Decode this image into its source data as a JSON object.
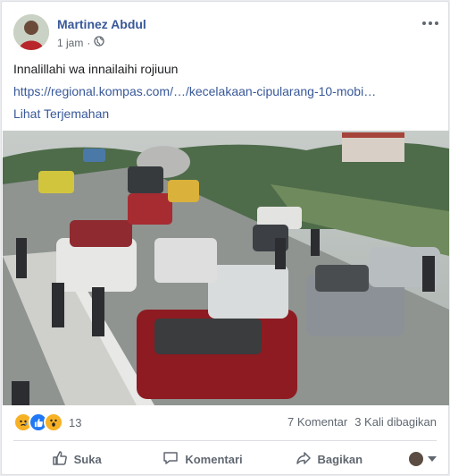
{
  "post": {
    "author": "Martinez Abdul",
    "time": "1 jam",
    "separator": "·",
    "privacy_icon": "globe-icon",
    "more_icon": "more-icon",
    "text": "Innalillahi wa innailaihi rojiuun",
    "link": "https://regional.kompas.com/…/kecelakaan-cipularang-10-mobi…",
    "translate": "Lihat Terjemahan"
  },
  "reactions": {
    "icons": [
      "sad-reaction-icon",
      "like-reaction-icon",
      "wow-reaction-icon"
    ],
    "count": "13"
  },
  "stats": {
    "comments": "7 Komentar",
    "shares": "3 Kali dibagikan"
  },
  "actions": {
    "like": "Suka",
    "comment": "Komentari",
    "share": "Bagikan"
  },
  "colors": {
    "link": "#385898",
    "text": "#1c1e21",
    "muted": "#606770",
    "like_blue": "#2078f4",
    "reaction_yellow": "#f7b125"
  }
}
